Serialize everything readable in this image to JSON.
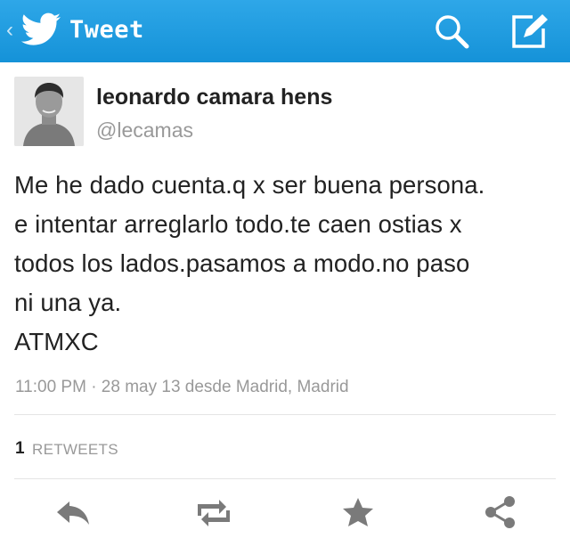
{
  "header": {
    "title": "Tweet",
    "back_icon": "chevron-left-icon",
    "logo_icon": "twitter-bird-icon",
    "search_icon": "search-icon",
    "compose_icon": "compose-icon",
    "background": "#1b9be0"
  },
  "tweet": {
    "author_name": "leonardo camara hens",
    "handle": "@lecamas",
    "text": "Me he dado cuenta.q x ser buena persona.\ne intentar arreglarlo todo.te caen ostias x\ntodos los lados.pasamos a modo.no paso\nni una ya.\nATMXC",
    "timestamp": "11:00 PM · 28 may 13 desde Madrid, Madrid"
  },
  "stats": {
    "retweet_count": "1",
    "retweet_label": "RETWEETS"
  },
  "actions": {
    "reply_icon": "reply-icon",
    "retweet_icon": "retweet-icon",
    "favorite_icon": "star-icon",
    "share_icon": "share-icon",
    "icon_color": "#7a7a7a"
  }
}
